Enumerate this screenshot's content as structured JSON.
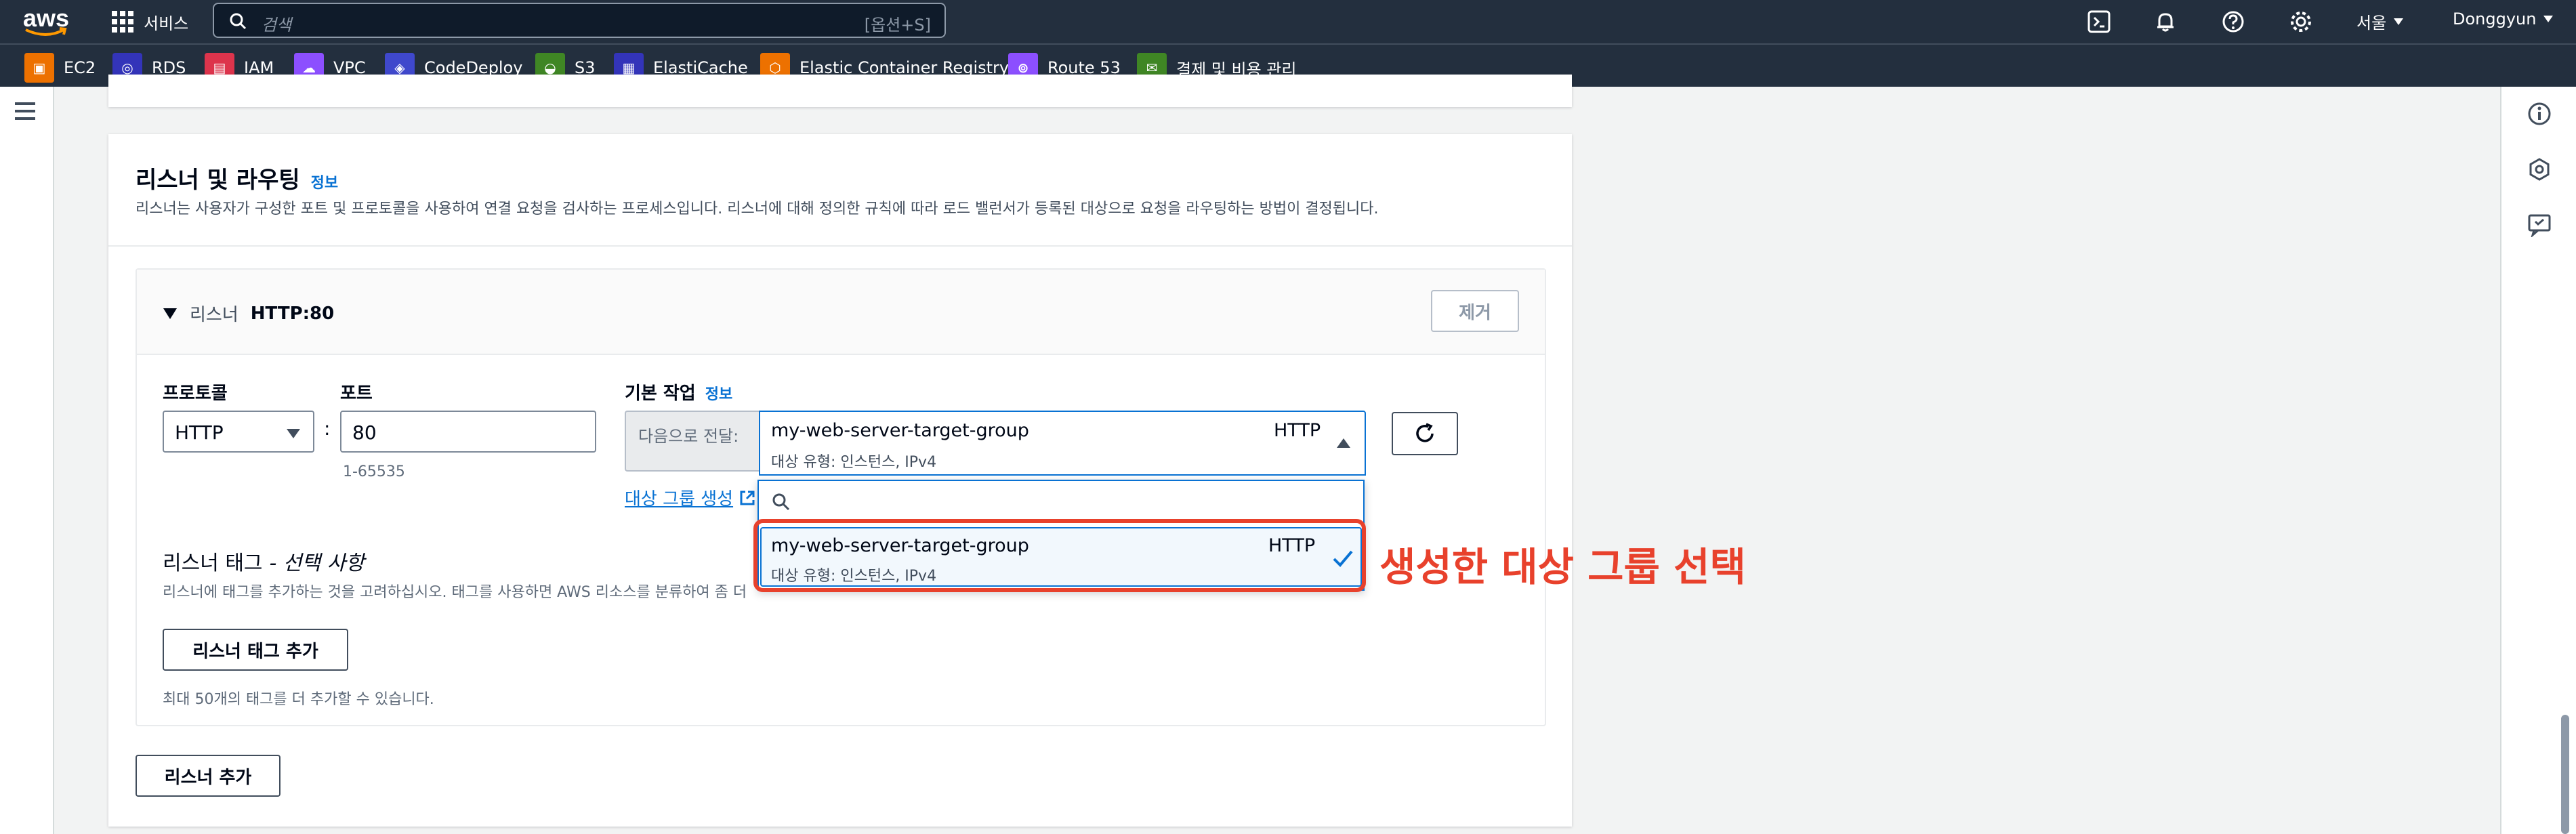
{
  "nav": {
    "logo_text": "aws",
    "services_label": "서비스",
    "search_placeholder": "검색",
    "search_shortcut": "[옵션+S]",
    "region": "서울",
    "user": "Donggyun"
  },
  "favorites": [
    {
      "label": "EC2",
      "icon": "ec2-icon",
      "color": "#ed7100"
    },
    {
      "label": "RDS",
      "icon": "rds-icon",
      "color": "#3334b9"
    },
    {
      "label": "IAM",
      "icon": "iam-icon",
      "color": "#dd344c"
    },
    {
      "label": "VPC",
      "icon": "vpc-icon",
      "color": "#8c4fff"
    },
    {
      "label": "CodeDeploy",
      "icon": "codedeploy-icon",
      "color": "#3f48cc"
    },
    {
      "label": "S3",
      "icon": "s3-icon",
      "color": "#3f8624"
    },
    {
      "label": "ElastiCache",
      "icon": "elasticache-icon",
      "color": "#3334b9"
    },
    {
      "label": "Elastic Container Registry",
      "icon": "ecr-icon",
      "color": "#ed7100"
    },
    {
      "label": "Route 53",
      "icon": "route53-icon",
      "color": "#8c4fff"
    },
    {
      "label": "결제 및 비용 관리",
      "icon": "billing-icon",
      "color": "#3f8624"
    }
  ],
  "section": {
    "title": "리스너 및 라우팅",
    "info": "정보",
    "description": "리스너는 사용자가 구성한 포트 및 프로토콜을 사용하여 연결 요청을 검사하는 프로세스입니다. 리스너에 대해 정의한 규칙에 따라 로드 밸런서가 등록된 대상으로 요청을 라우팅하는 방법이 결정됩니다."
  },
  "listener": {
    "header_prefix": "리스너",
    "header_name": "HTTP:80",
    "remove_button": "제거",
    "protocol_label": "프로토콜",
    "protocol_value": "HTTP",
    "colon": ":",
    "port_label": "포트",
    "port_value": "80",
    "port_hint": "1-65535",
    "action_label": "기본 작업",
    "action_info": "정보",
    "forward_label": "다음으로 전달:",
    "selected_group": "my-web-server-target-group",
    "selected_protocol": "HTTP",
    "selected_sub": "대상 유형: 인스턴스, IPv4",
    "create_group_link": "대상 그룹 생성",
    "tags_title": "리스너 태그",
    "tags_title_optional": "- 선택 사항",
    "tags_desc_visible": "리스너에 태그를 추가하는 것을 고려하십시오. 태그를 사용하면 AWS 리소스를 분류하여 좀 더",
    "add_tag_button": "리스너 태그 추가",
    "tags_limit": "최대 50개의 태그를 더 추가할 수 있습니다."
  },
  "dropdown": {
    "search_placeholder": "",
    "options": [
      {
        "name": "my-web-server-target-group",
        "protocol": "HTTP",
        "sub": "대상 유형: 인스턴스, IPv4",
        "selected": true
      }
    ]
  },
  "annotation": {
    "text": "생성한 대상 그룹 선택",
    "color": "#e8412c"
  },
  "add_listener_button": "리스너 추가"
}
